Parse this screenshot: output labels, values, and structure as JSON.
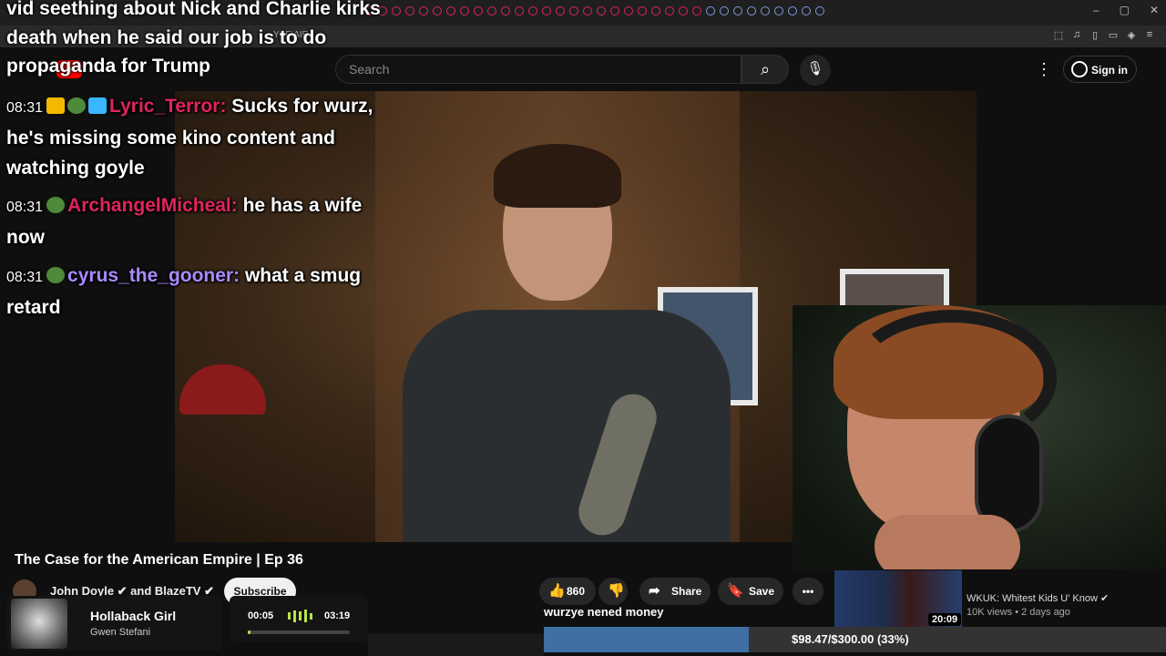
{
  "browser": {
    "url_fragment": "YSFIAIE",
    "window_controls": [
      "–",
      "▢",
      "✕"
    ]
  },
  "youtube": {
    "search_placeholder": "Search",
    "sign_in_label": "Sign in"
  },
  "chat": {
    "top_message": "vid seething about Nick and Charlie kirks death when he said our job is to do propaganda for Trump",
    "messages": [
      {
        "time": "08:31",
        "user": "Lyric_Terror",
        "text": "Sucks for wurz, he's missing some kino content and watching goyle"
      },
      {
        "time": "08:31",
        "user": "ArchangelMicheal",
        "text": "he has a wife now"
      },
      {
        "time": "08:31",
        "user": "cyrus_the_gooner",
        "text": "what a smug retard"
      }
    ]
  },
  "video": {
    "title": "The Case for the American Empire | Ep 36",
    "channel": "John Doyle ✔ and BlazeTV ✔",
    "subscribe_label": "Subscribe",
    "likes": "860",
    "share_label": "Share",
    "save_label": "Save"
  },
  "suggested": {
    "title": "WKUK: Whitest Kids U' Know ✔",
    "meta": "10K views • 2 days ago",
    "duration": "20:09"
  },
  "now_playing": {
    "song": "Hollaback Girl",
    "artist": "Gwen Stefani",
    "elapsed": "00:05",
    "length": "03:19",
    "progress": 0.03
  },
  "goal": {
    "message": "wurzye nened money",
    "label": "$98.47/$300.00 (33%)",
    "progress": 0.33
  },
  "colors": {
    "accent_red": "#e0245e",
    "accent_purple": "#a98aff",
    "goal_fill": "#3f6fa3",
    "player_green": "#b7e34a"
  }
}
